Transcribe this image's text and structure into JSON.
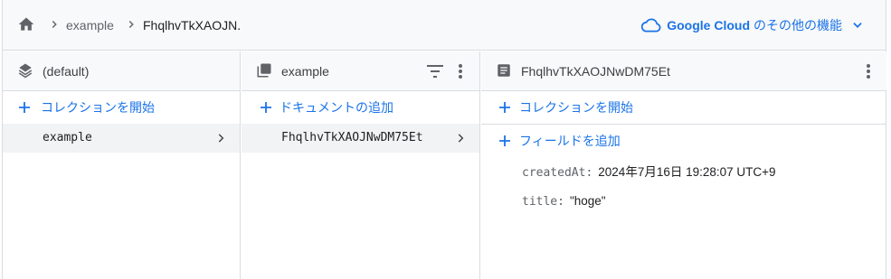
{
  "breadcrumb": {
    "items": [
      "example",
      "FhqlhvTkXAOJN."
    ],
    "icons": {
      "home": "home-icon",
      "separator": "chevron-right-icon"
    }
  },
  "header_link": {
    "brand": "Google Cloud",
    "rest": "のその他の機能",
    "icon": "cloud-icon",
    "color": "#1a73e8"
  },
  "panels": {
    "root": {
      "title": "(default)",
      "icon": "database-layers-icon",
      "add_label": "コレクションを開始",
      "items": [
        {
          "label": "example",
          "selected": true
        }
      ]
    },
    "collection": {
      "title": "example",
      "icon": "collection-icon",
      "add_label": "ドキュメントの追加",
      "items": [
        {
          "label": "FhqlhvTkXAOJNwDM75Et",
          "selected": true
        }
      ]
    },
    "document": {
      "title": "FhqlhvTkXAOJNwDM75Et",
      "icon": "document-icon",
      "add_collection_label": "コレクションを開始",
      "add_field_label": "フィールドを追加",
      "fields": [
        {
          "key": "createdAt:",
          "value": "2024年7月16日 19:28:07 UTC+9"
        },
        {
          "key": "title:",
          "value": "\"hoge\""
        }
      ]
    }
  }
}
